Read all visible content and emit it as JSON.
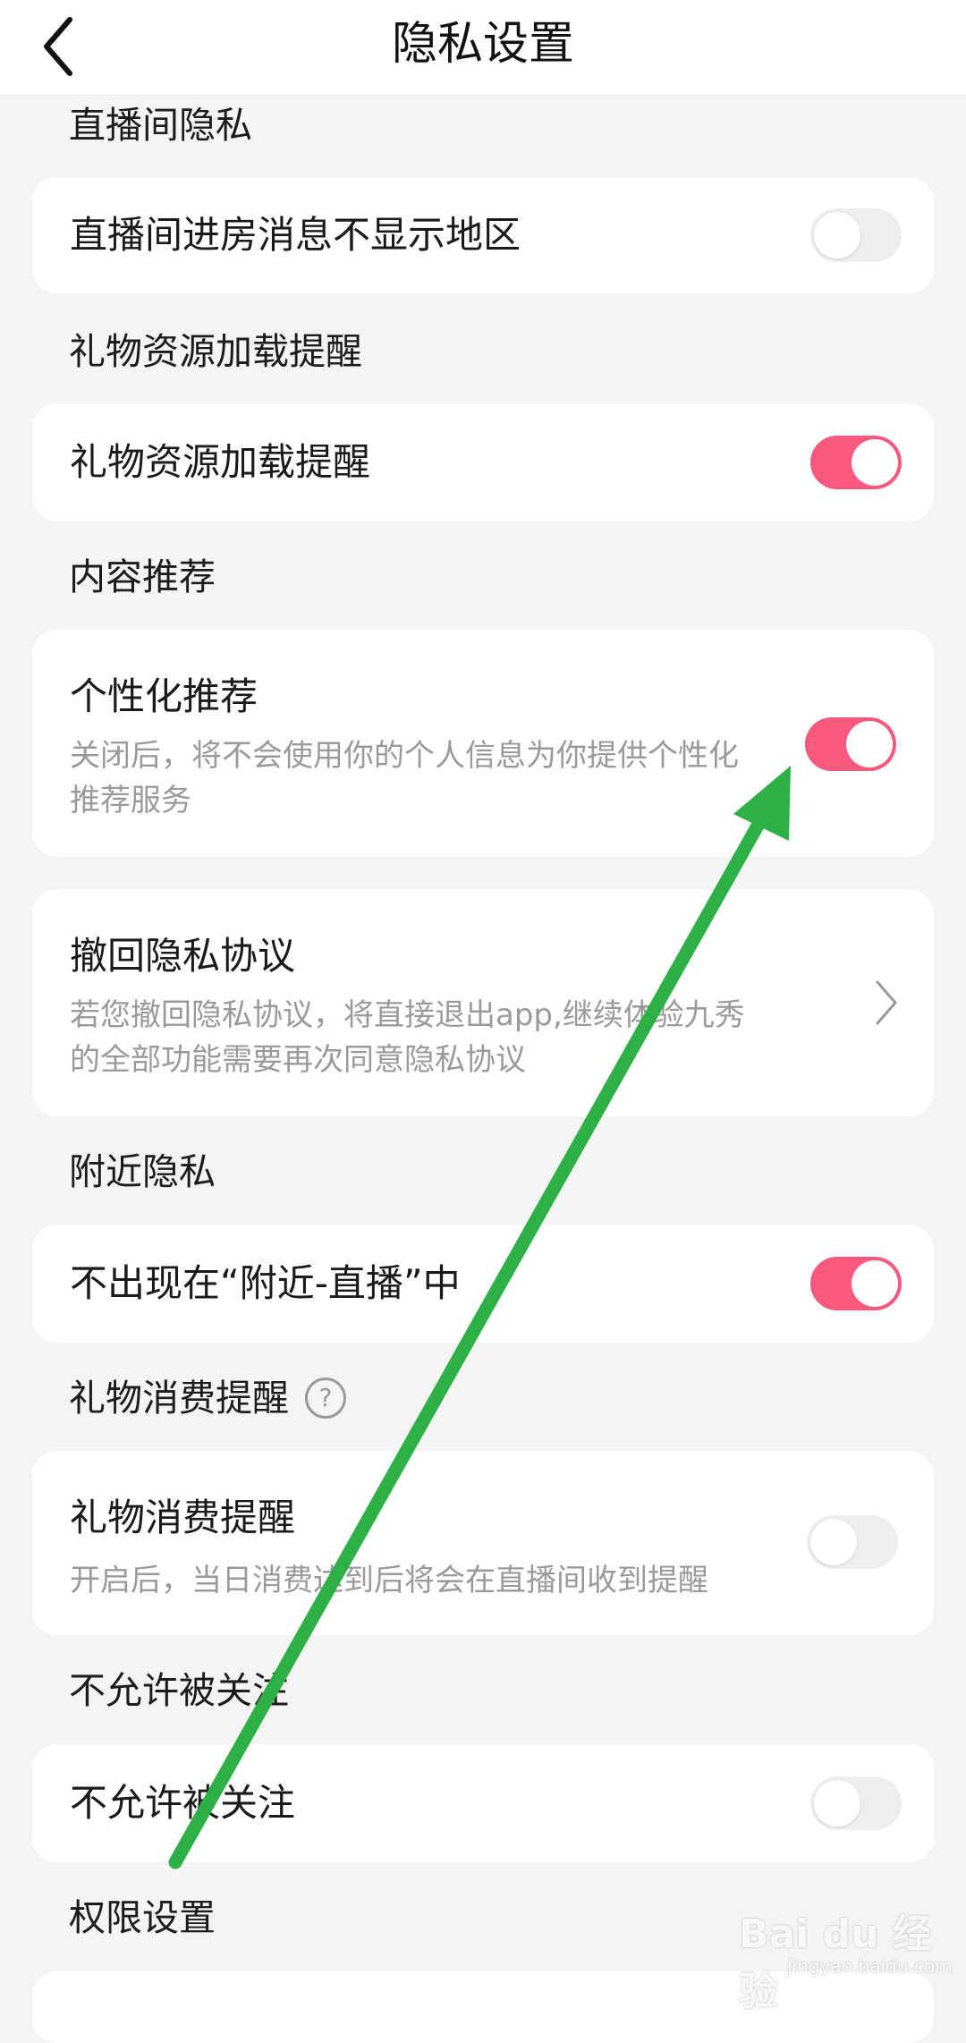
{
  "header": {
    "title": "隐私设置"
  },
  "sections": {
    "live_privacy": "直播间隐私",
    "gift_loading": "礼物资源加载提醒",
    "content_recommend": "内容推荐",
    "nearby_privacy": "附近隐私",
    "gift_spend": "礼物消费提醒",
    "no_follow": "不允许被关注",
    "permissions": "权限设置"
  },
  "items": {
    "hide_region": {
      "title": "直播间进房消息不显示地区",
      "enabled": false
    },
    "gift_loading": {
      "title": "礼物资源加载提醒",
      "enabled": true
    },
    "personalized": {
      "title": "个性化推荐",
      "desc": "关闭后，将不会使用你的个人信息为你提供个性化推荐服务",
      "enabled": true
    },
    "revoke": {
      "title": "撤回隐私协议",
      "desc": "若您撤回隐私协议，将直接退出app,继续体验九秀的全部功能需要再次同意隐私协议"
    },
    "nearby": {
      "title": "不出现在“附近-直播”中",
      "enabled": true
    },
    "gift_spend": {
      "title": "礼物消费提醒",
      "desc": "开启后，当日消费达到后将会在直播间收到提醒",
      "enabled": false
    },
    "no_follow": {
      "title": "不允许被关注",
      "enabled": false
    }
  },
  "watermark": {
    "brand": "Bai du 经验",
    "url": "jingyan.baidu.com"
  },
  "colors": {
    "toggle_on": "#f7587d",
    "toggle_off": "#eeeeee",
    "annotation_arrow": "#2db045"
  }
}
